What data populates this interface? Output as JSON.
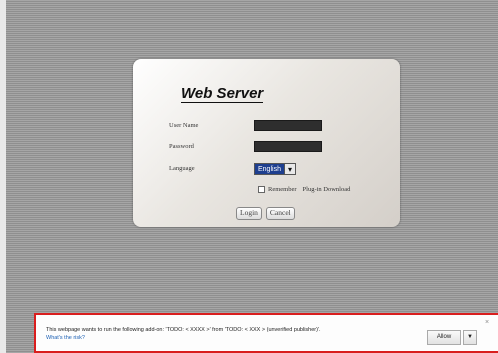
{
  "login": {
    "title": "Web Server",
    "username_label": "User Name",
    "password_label": "Password",
    "language_label": "Language",
    "language_value": "English",
    "remember_label": "Remember",
    "plugin_label": "Plug-in Download",
    "login_button": "Login",
    "cancel_button": "Cancel"
  },
  "notification": {
    "message": "This webpage wants to run the following add-on: 'TODO: <  XXXX  >' from 'TODO: <  XXX  > (unverified publisher)'.",
    "risk_link": "What's the risk?",
    "allow_button": "Allow",
    "dropdown_glyph": "▼",
    "close_glyph": "×"
  },
  "icons": {
    "select_arrow": "▾"
  },
  "colors": {
    "alert_border": "#d91e1e",
    "select_highlight": "#1e3f8f",
    "link": "#1a5fb4"
  }
}
